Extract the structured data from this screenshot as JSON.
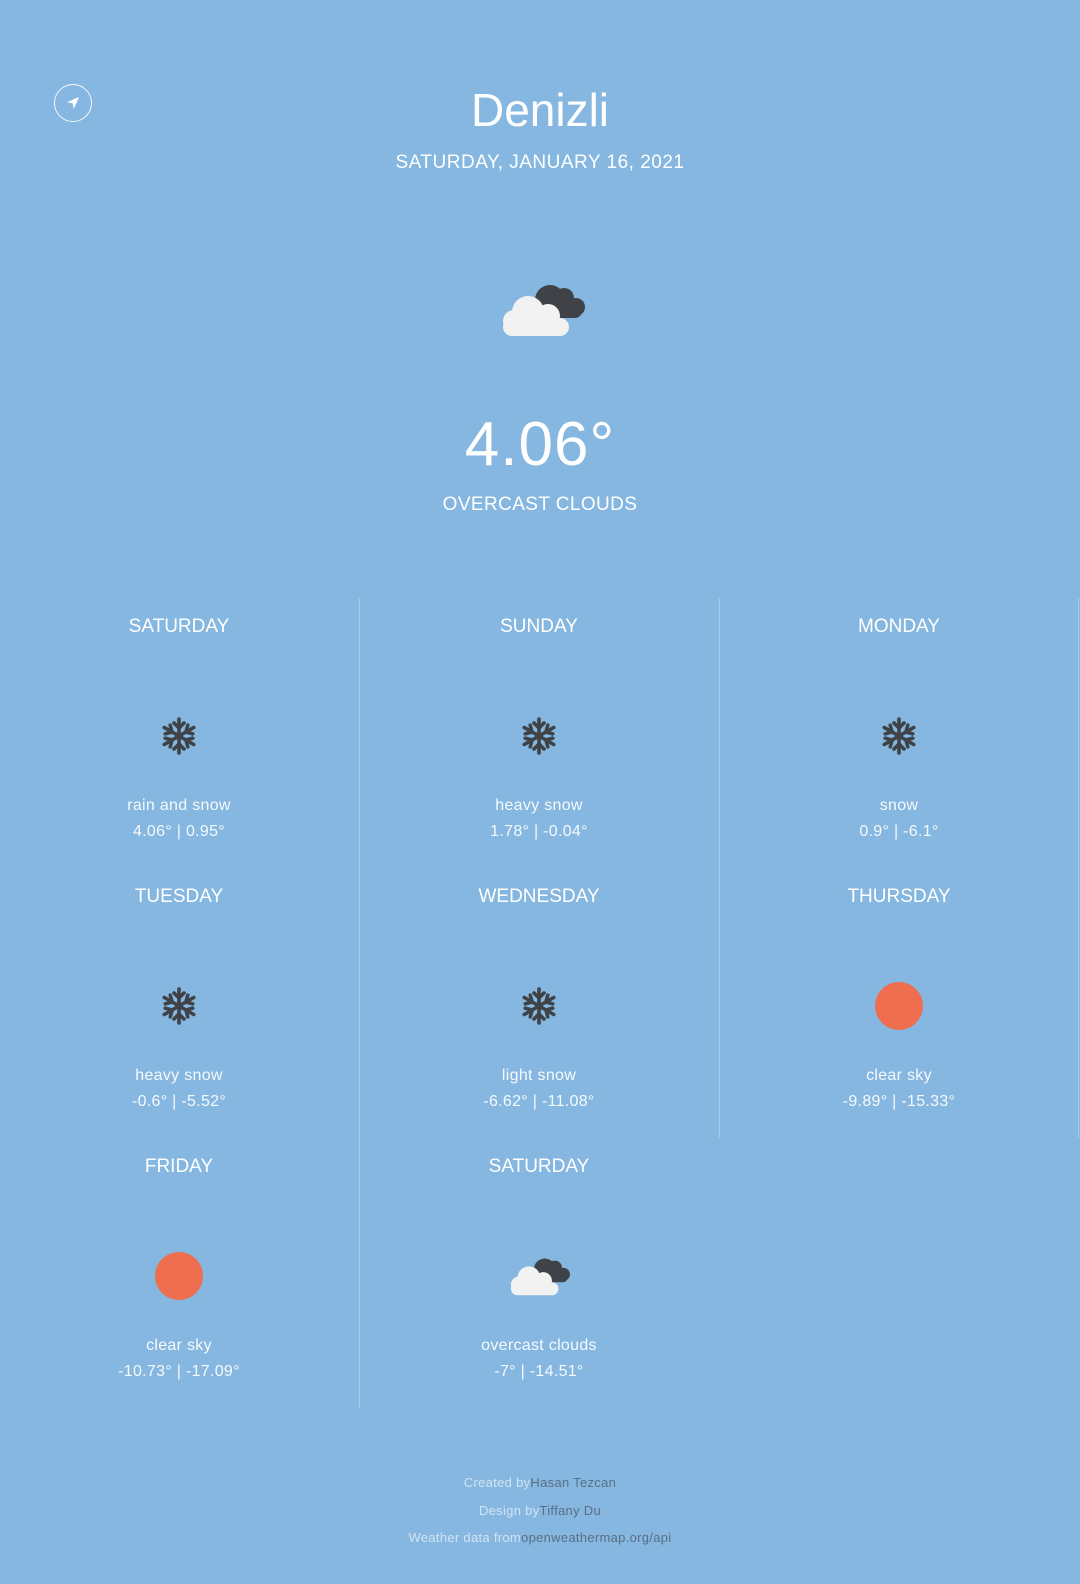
{
  "city": "Denizli",
  "date": "SATURDAY, JANUARY 16, 2021",
  "current": {
    "temperature": "4.06°",
    "description": "OVERCAST CLOUDS",
    "icon": "overcast-clouds-icon"
  },
  "forecast": [
    {
      "day": "SATURDAY",
      "description": "rain and snow",
      "temps": "4.06° | 0.95°",
      "icon": "snowflake-icon"
    },
    {
      "day": "SUNDAY",
      "description": "heavy snow",
      "temps": "1.78° | -0.04°",
      "icon": "snowflake-icon"
    },
    {
      "day": "MONDAY",
      "description": "snow",
      "temps": "0.9° | -6.1°",
      "icon": "snowflake-icon"
    },
    {
      "day": "TUESDAY",
      "description": "heavy snow",
      "temps": "-0.6° | -5.52°",
      "icon": "snowflake-icon"
    },
    {
      "day": "WEDNESDAY",
      "description": "light snow",
      "temps": "-6.62° | -11.08°",
      "icon": "snowflake-icon"
    },
    {
      "day": "THURSDAY",
      "description": "clear sky",
      "temps": "-9.89° | -15.33°",
      "icon": "sun-icon"
    },
    {
      "day": "FRIDAY",
      "description": "clear sky",
      "temps": "-10.73° | -17.09°",
      "icon": "sun-icon"
    },
    {
      "day": "SATURDAY",
      "description": "overcast clouds",
      "temps": "-7° | -14.51°",
      "icon": "overcast-clouds-icon"
    }
  ],
  "footer": {
    "created_by_label": "Created by",
    "created_by_name": "Hasan Tezcan",
    "design_by_label": "Design by",
    "design_by_name": "Tiffany Du",
    "data_from_label": "Weather data from",
    "data_from_link": "openweathermap.org/api"
  },
  "colors": {
    "background": "#85b7e0",
    "text": "#ffffff",
    "sun": "#ee6e4f",
    "icon_dark": "#3f4347",
    "cloud_light": "#f2f2f2",
    "link": "#5a6f84"
  }
}
